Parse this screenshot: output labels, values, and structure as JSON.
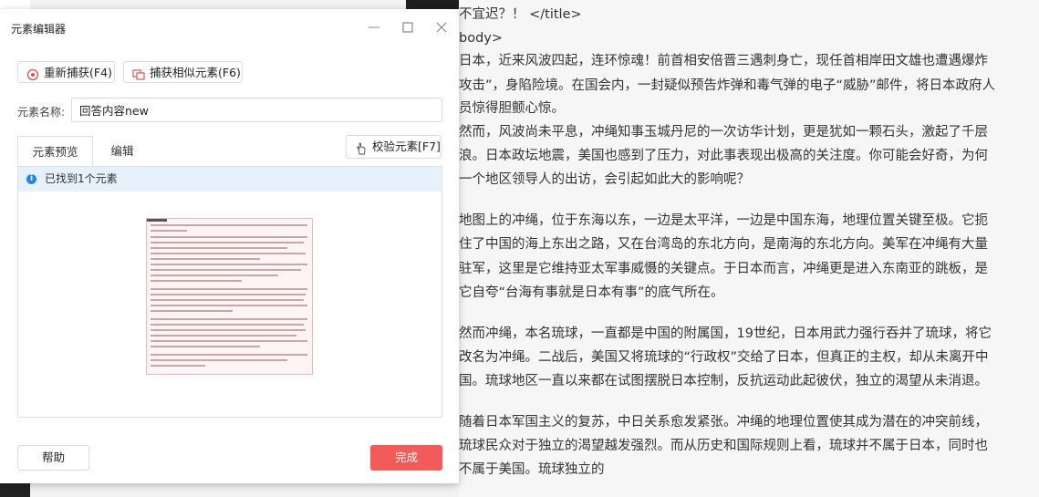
{
  "dialog": {
    "title": "元素编辑器",
    "recapture_label": "重新捕获(F4)",
    "capture_similar_label": "捕获相似元素(F6)",
    "name_label": "元素名称:",
    "name_value": "回答内容new",
    "tabs": [
      "元素预览",
      "编辑"
    ],
    "validate_label": "校验元素[F7]",
    "found_text": "已找到1个元素",
    "help_label": "帮助",
    "done_label": "完成",
    "accent_color": "#f35a5a",
    "info_color": "#1e88e5"
  },
  "editor": {
    "lines": [
      "不宜迟？！ </title>",
      "body>",
      "日本，近来风波四起，连环惊魂！前首相安倍晋三遇刺身亡，现任首相岸田文雄也遭遇爆炸",
      "攻击”，身陷险境。在国会内，一封疑似预告炸弹和毒气弹的电子“威胁”邮件，将日本政府人",
      "员惊得胆颤心惊。",
      "然而，风波尚未平息，冲绳知事玉城丹尼的一次访华计划，更是犹如一颗石头，激起了千层",
      "浪。日本政坛地震，美国也感到了压力，对此事表现出极高的关注度。你可能会好奇，为何",
      "一个地区领导人的出访，会引起如此大的影响呢？",
      "地图上的冲绳，位于东海以东，一边是太平洋，一边是中国东海，地理位置关键至极。它扼",
      "住了中国的海上东出之路，又在台湾岛的东北方向，是南海的东北方向。美军在冲绳有大量",
      "驻军，这里是它维持亚太军事威慑的关键点。于日本而言，冲绳更是进入东南亚的跳板，是",
      "它自夸“台海有事就是日本有事”的底气所在。",
      "然而冲绳，本名琉球，一直都是中国的附属国，19世纪，日本用武力强行吞并了琉球，将它",
      "改名为冲绳。二战后，美国又将琉球的“行政权”交给了日本，但真正的主权，却从未离开中",
      "国。琉球地区一直以来都在试图摆脱日本控制，反抗运动此起彼伏，独立的渴望从未消退。",
      "随着日本军国主义的复苏，中日关系愈发紧张。冲绳的地理位置使其成为潜在的冲突前线，",
      "琉球民众对于独立的渴望越发强烈。而从历史和国际规则上看，琉球并不属于日本，同时也",
      "不属于美国。琉球独立的"
    ]
  }
}
